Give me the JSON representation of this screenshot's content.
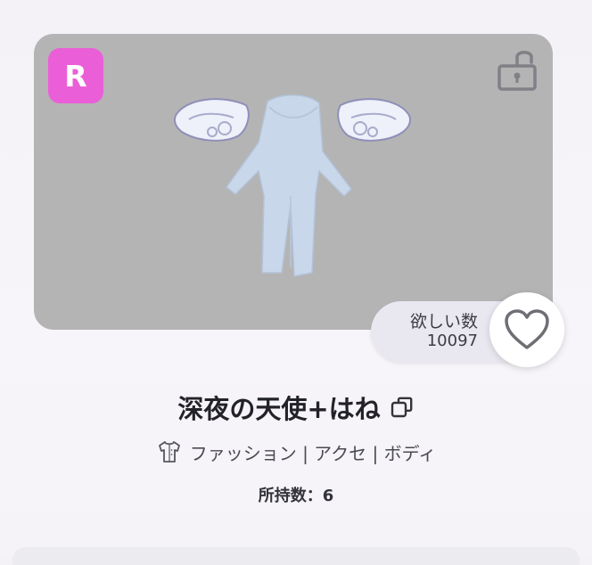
{
  "item": {
    "rarity": "R",
    "name": "深夜の天使+はね",
    "category": "ファッション | アクセ | ボディ",
    "owned": "所持数：6"
  },
  "wishlist": {
    "label": "欲しい数",
    "count": "10097"
  },
  "icons": {
    "lock": "unlocked-padlock-icon",
    "heart": "heart-outline-icon",
    "copy": "copy-icon",
    "category": "shirt-icon"
  },
  "colors": {
    "rarity_badge": "#ea5fd7",
    "preview_bg": "#b4b4b4",
    "wing": "#e4e6f4",
    "outfit": "#c9d7ea"
  }
}
